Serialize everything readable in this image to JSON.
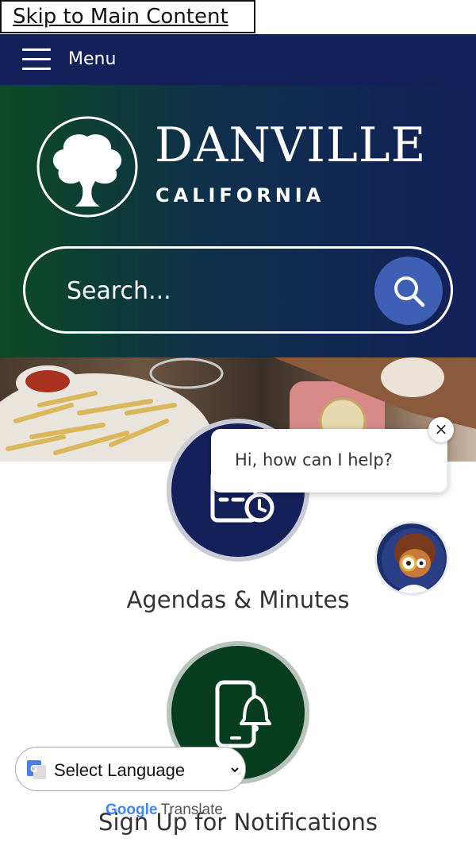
{
  "skip_link": {
    "label": "Skip to Main Content"
  },
  "menu": {
    "label": "Menu"
  },
  "logo": {
    "title": "DANVILLE",
    "subtitle": "CALIFORNIA"
  },
  "search": {
    "placeholder": "Search..."
  },
  "quick_links": [
    {
      "label": "Agendas & Minutes",
      "icon": "calendar-clock-icon"
    },
    {
      "label": "Sign Up for Notifications",
      "icon": "phone-bell-icon"
    }
  ],
  "chat": {
    "greeting": "Hi, how can I help?",
    "close": "×"
  },
  "translate": {
    "selected": "Select Language",
    "google": "Google",
    "translate_label": "Translate"
  },
  "colors": {
    "navy": "#13205a",
    "green": "#0c4a24",
    "accent_blue": "#3e5fb4"
  }
}
